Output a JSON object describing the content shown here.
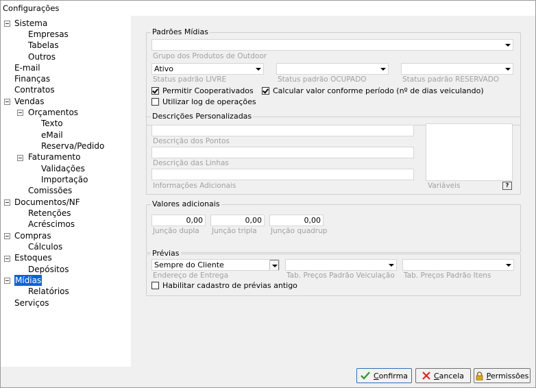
{
  "window": {
    "title": "Configurações"
  },
  "tree": {
    "sistema": "Sistema",
    "empresas": "Empresas",
    "tabelas": "Tabelas",
    "outros": "Outros",
    "email": "E-mail",
    "financas": "Finanças",
    "contratos": "Contratos",
    "vendas": "Vendas",
    "orcamentos": "Orçamentos",
    "texto": "Texto",
    "email2": "eMail",
    "reserva": "Reserva/Pedido",
    "faturamento": "Faturamento",
    "validacoes": "Validações",
    "importacao": "Importação",
    "comissoes": "Comissões",
    "documentos": "Documentos/NF",
    "retencoes": "Retenções",
    "acrescimos": "Acréscimos",
    "compras": "Compras",
    "calculos": "Cálculos",
    "estoques": "Estoques",
    "depositos": "Depósitos",
    "midias": "Mídias",
    "relatorios": "Relatórios",
    "servicos": "Serviços"
  },
  "padroes": {
    "legend": "Padrões Mídias",
    "grupo_value": "",
    "grupo_label": "Grupo dos Produtos de Outdoor",
    "livre_value": "Ativo",
    "livre_label": "Status padrão LIVRE",
    "ocupado_value": "",
    "ocupado_label": "Status padrão OCUPADO",
    "reservado_value": "",
    "reservado_label": "Status padrão RESERVADO",
    "cooperativados_label": "Permitir Cooperativados",
    "cooperativados_checked": true,
    "calcular_label": "Calcular valor conforme período (nº de dias veiculando)",
    "calcular_checked": true,
    "log_label": "Utilizar log de operações",
    "log_checked": false
  },
  "descricoes": {
    "legend": "Descrições Personalizadas",
    "pontos_label": "Descrição dos Pontos",
    "linhas_label": "Descrição das Linhas",
    "info_label": "Informações Adicionais",
    "variaveis_label": "Variáveis",
    "help_glyph": "?"
  },
  "valores": {
    "legend": "Valores adicionais",
    "dupla_value": "0,00",
    "dupla_label": "Junção dupla",
    "tripla_value": "0,00",
    "tripla_label": "Junção tripla",
    "quadrupla_value": "0,00",
    "quadrupla_label": "Junção quadrup"
  },
  "previas": {
    "legend": "Prévias",
    "endereco_value": "Sempre do Cliente",
    "endereco_label": "Endereço de Entrega",
    "veiculacao_value": "",
    "veiculacao_label": "Tab. Preços Padrão Veiculação",
    "itens_value": "",
    "itens_label": "Tab. Preços Padrão Itens",
    "habilitar_label": "Habilitar cadastro de prévias antigo",
    "habilitar_checked": false
  },
  "buttons": {
    "confirma_u": "C",
    "confirma_rest": "onfirma",
    "cancela_u": "C",
    "cancela_rest": "ancela",
    "permissoes_u": "P",
    "permissoes_rest": "ermissões"
  },
  "icons": {
    "confirma": "check-icon",
    "cancela": "x-icon",
    "permissoes": "lock-icon"
  },
  "colors": {
    "selection": "#0a64d8",
    "check": "#2e9c2e",
    "cancel": "#d62020",
    "lock": "#d9a420"
  }
}
